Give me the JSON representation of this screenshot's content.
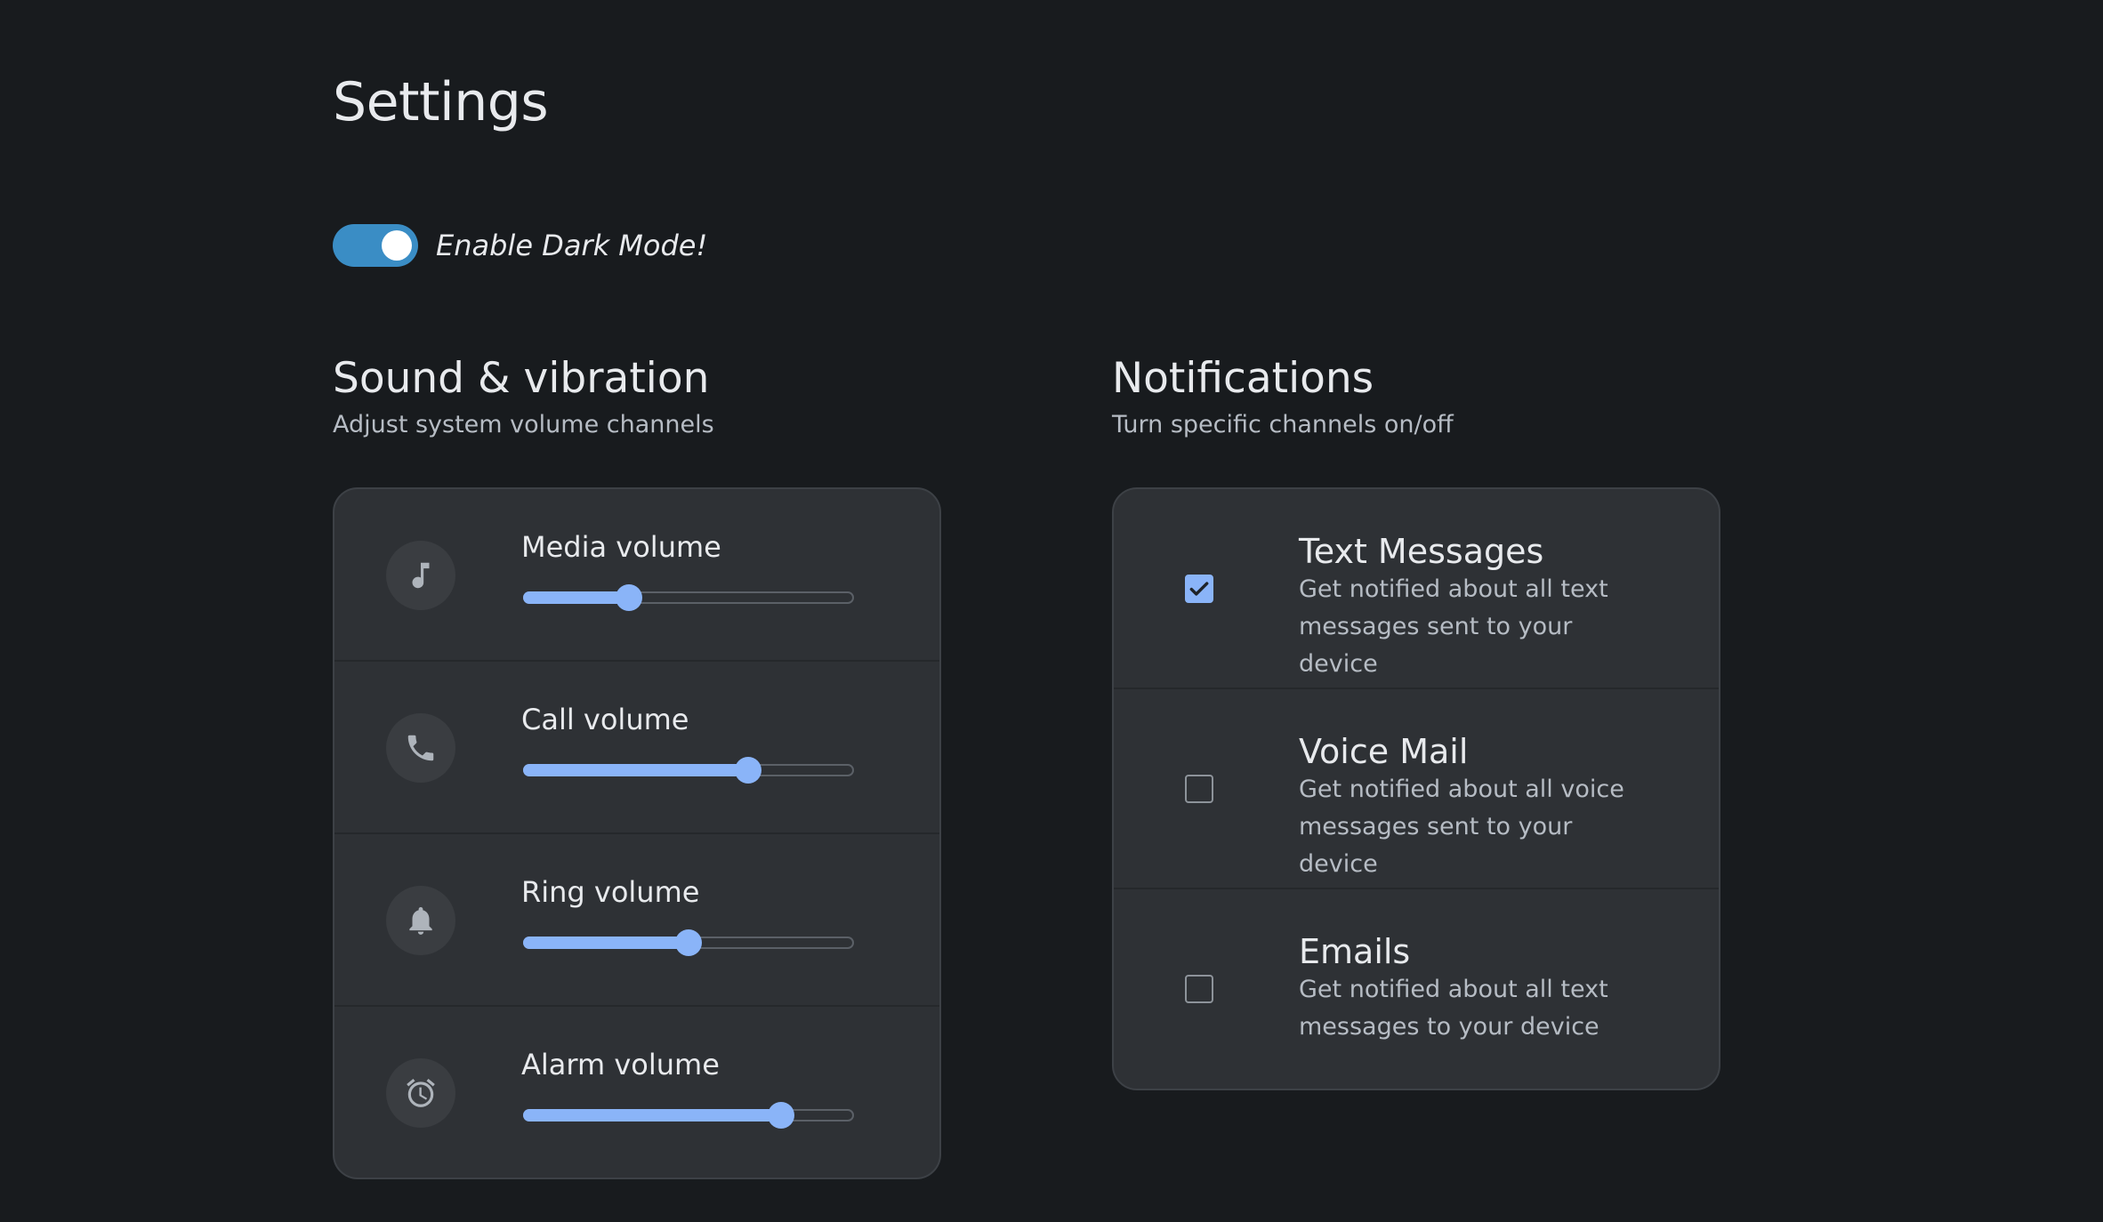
{
  "page": {
    "title": "Settings"
  },
  "dark_mode": {
    "label": "Enable Dark Mode!",
    "enabled": true
  },
  "colors": {
    "accent": "#8ab4f8",
    "toggle": "#3a8dc5",
    "background": "#181b1e",
    "card": "#2e3135"
  },
  "sound": {
    "title": "Sound & vibration",
    "subtitle": "Adjust system volume channels",
    "channels": [
      {
        "label": "Media volume",
        "icon": "music-note-icon",
        "level": 32
      },
      {
        "label": "Call volume",
        "icon": "phone-icon",
        "level": 68
      },
      {
        "label": "Ring volume",
        "icon": "bell-icon",
        "level": 50
      },
      {
        "label": "Alarm volume",
        "icon": "alarm-clock-icon",
        "level": 78
      }
    ]
  },
  "notifications": {
    "title": "Notifications",
    "subtitle": "Turn specific channels on/off",
    "channels": [
      {
        "title": "Text Messages",
        "description": "Get notified about all text messages sent to your device",
        "checked": true
      },
      {
        "title": "Voice Mail",
        "description": "Get notified about all voice messages sent to your device",
        "checked": false
      },
      {
        "title": "Emails",
        "description": "Get notified about all text messages to your device",
        "checked": false
      }
    ]
  }
}
